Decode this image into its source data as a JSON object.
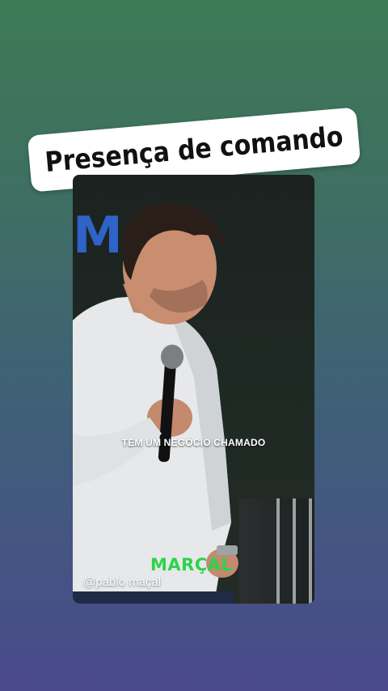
{
  "title": "Presença de comando",
  "video": {
    "caption": "TEM UM NEGÓCIO CHAMADO",
    "watermark_logo": "MARÇAL",
    "handle": "@pablo maçal",
    "screen_letter": "M"
  },
  "colors": {
    "background_top": "#3d7a55",
    "background_bottom": "#4a4a8c",
    "logo_green": "#2fd24a",
    "screen_blue": "#2e63c7"
  }
}
